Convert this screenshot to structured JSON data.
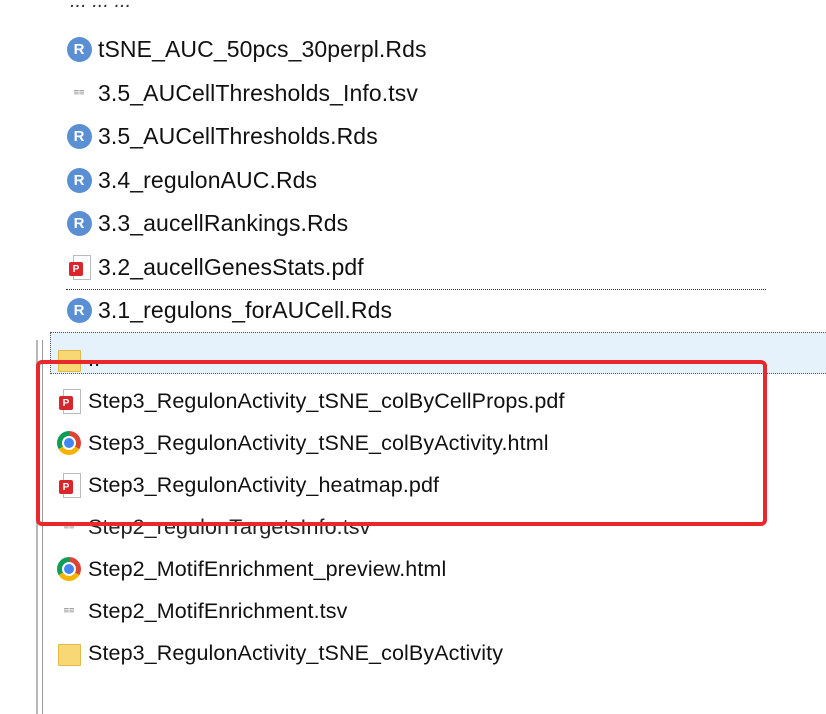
{
  "top_fragment": "...  ...  ...",
  "upper_files": [
    {
      "name": "tSNE_AUC_50pcs_30perpl.Rds",
      "icon": "r-file-icon"
    },
    {
      "name": "3.5_AUCellThresholds_Info.tsv",
      "icon": "tsv-file-icon"
    },
    {
      "name": "3.5_AUCellThresholds.Rds",
      "icon": "r-file-icon"
    },
    {
      "name": "3.4_regulonAUC.Rds",
      "icon": "r-file-icon"
    },
    {
      "name": "3.3_aucellRankings.Rds",
      "icon": "r-file-icon"
    },
    {
      "name": "3.2_aucellGenesStats.pdf",
      "icon": "pdf-file-icon"
    },
    {
      "name": "3.1_regulons_forAUCell.Rds",
      "icon": "r-file-icon"
    }
  ],
  "lower_files": [
    {
      "name": "..",
      "icon": "folder-icon"
    },
    {
      "name": "Step3_RegulonActivity_tSNE_colByCellProps.pdf",
      "icon": "pdf-file-icon"
    },
    {
      "name": "Step3_RegulonActivity_tSNE_colByActivity.html",
      "icon": "chrome-html-icon"
    },
    {
      "name": "Step3_RegulonActivity_heatmap.pdf",
      "icon": "pdf-file-icon"
    },
    {
      "name": "Step2_regulonTargetsInfo.tsv",
      "icon": "tsv-file-icon"
    },
    {
      "name": "Step2_MotifEnrichment_preview.html",
      "icon": "chrome-html-icon"
    },
    {
      "name": "Step2_MotifEnrichment.tsv",
      "icon": "tsv-file-icon"
    },
    {
      "name": "Step3_RegulonActivity_tSNE_colByActivity",
      "icon": "folder-icon"
    }
  ],
  "colors": {
    "highlight": "#e8282b",
    "r_icon": "#5b8fd4",
    "pdf_badge": "#d9262c",
    "folder": "#f8d775",
    "selection": "#e5f1fb"
  }
}
